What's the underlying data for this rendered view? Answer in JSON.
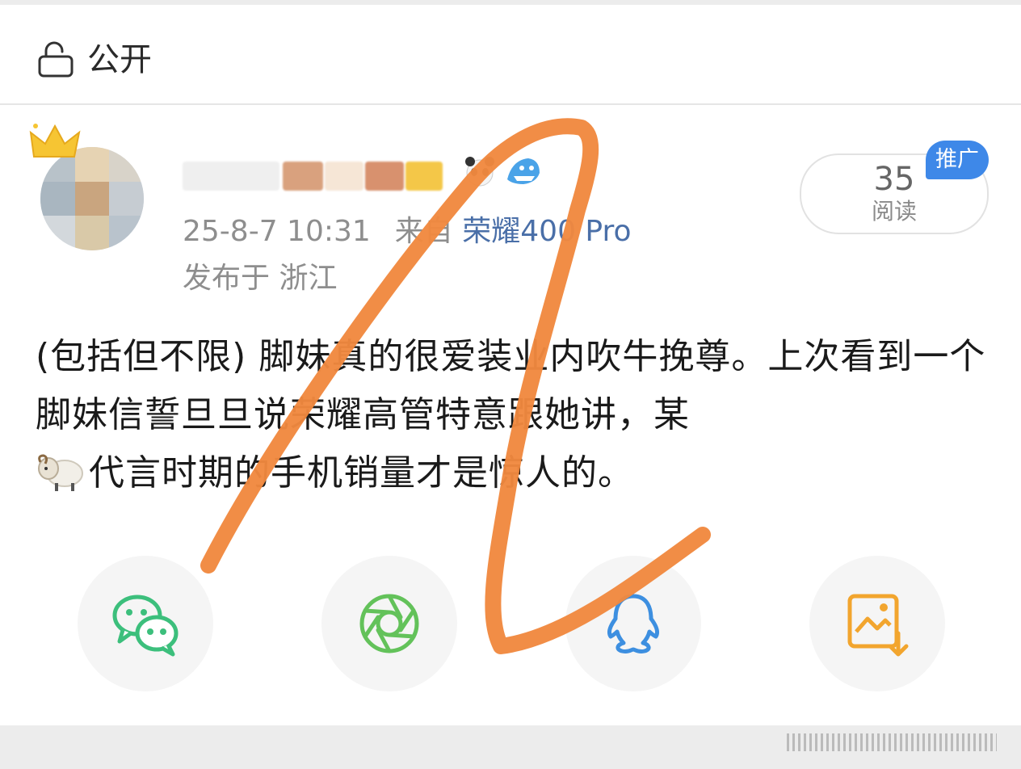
{
  "visibility": {
    "label": "公开",
    "icon": "unlock-icon"
  },
  "post": {
    "timestamp": "25-8-7 10:31",
    "source_prefix": "来自",
    "device": "荣耀400 Pro",
    "location": "发布于 浙江",
    "read_count": "35",
    "read_label": "阅读",
    "promo_badge": "推广",
    "text": "(包括但不限) 脚妹真的很爱装业内吹牛挽尊。上次看到一个脚妹信誓旦旦说荣耀高管特意跟她讲，某",
    "text_tail": "代言时期的手机销量才是惊人的。"
  },
  "share": [
    {
      "name": "wechat",
      "icon": "wechat-icon",
      "color": "#3cbf7c"
    },
    {
      "name": "moments",
      "icon": "moments-icon",
      "color": "#63c25a"
    },
    {
      "name": "qq",
      "icon": "qq-icon",
      "color": "#3d8fe0"
    },
    {
      "name": "save-image",
      "icon": "save-image-icon",
      "color": "#f2a52e"
    }
  ],
  "colors": {
    "accent_blue": "#3e88e8",
    "scribble_orange": "#f0883e",
    "device_link": "#4a6fa8",
    "meta_gray": "#8e8e8e"
  }
}
